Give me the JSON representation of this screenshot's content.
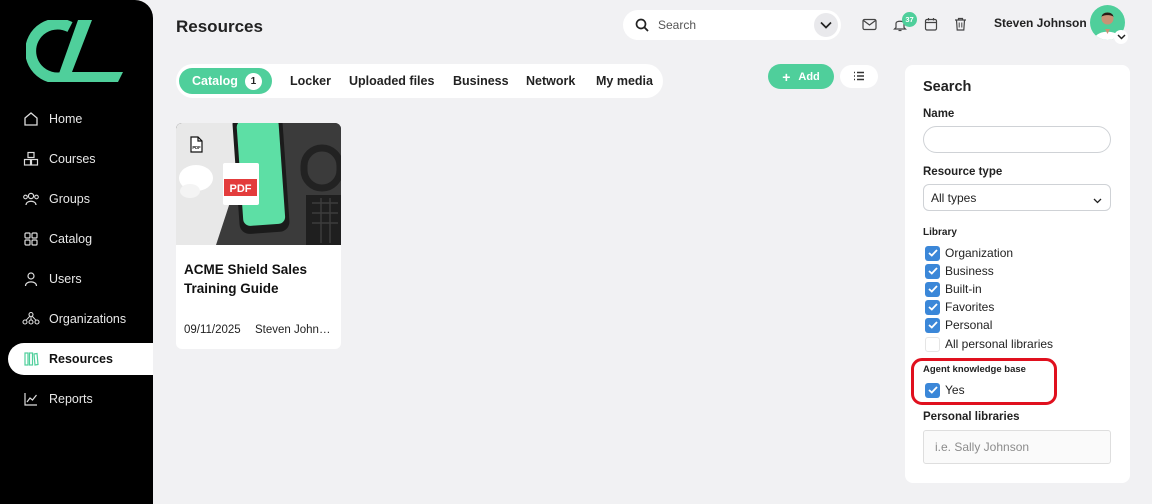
{
  "sidebar": {
    "items": [
      {
        "label": "Home",
        "icon": "home-icon"
      },
      {
        "label": "Courses",
        "icon": "courses-icon"
      },
      {
        "label": "Groups",
        "icon": "groups-icon"
      },
      {
        "label": "Catalog",
        "icon": "catalog-icon"
      },
      {
        "label": "Users",
        "icon": "user-icon"
      },
      {
        "label": "Organizations",
        "icon": "organizations-icon"
      },
      {
        "label": "Resources",
        "icon": "resources-icon",
        "active": true
      },
      {
        "label": "Reports",
        "icon": "reports-icon"
      }
    ]
  },
  "header": {
    "title": "Resources",
    "search_placeholder": "Search",
    "notification_count": "37",
    "user_name": "Steven Johnson"
  },
  "tabs": [
    {
      "label": "Catalog",
      "count": "1",
      "active": true
    },
    {
      "label": "Locker"
    },
    {
      "label": "Uploaded files"
    },
    {
      "label": "Business"
    },
    {
      "label": "Network"
    },
    {
      "label": "My media"
    }
  ],
  "toolbar": {
    "add_label": "Add"
  },
  "cards": [
    {
      "file_type": "PDF",
      "title": "ACME Shield Sales Training Guide",
      "date": "09/11/2025",
      "author": "Steven Johnson"
    }
  ],
  "filters": {
    "heading": "Search",
    "name_label": "Name",
    "name_value": "",
    "resource_type_label": "Resource type",
    "resource_type_value": "All types",
    "library_label": "Library",
    "library_options": [
      {
        "label": "Organization",
        "checked": true
      },
      {
        "label": "Business",
        "checked": true
      },
      {
        "label": "Built-in",
        "checked": true
      },
      {
        "label": "Favorites",
        "checked": true
      },
      {
        "label": "Personal",
        "checked": true
      },
      {
        "label": "All personal libraries",
        "checked": false
      }
    ],
    "agent_kb_label": "Agent knowledge base",
    "agent_kb_option": {
      "label": "Yes",
      "checked": true
    },
    "personal_libraries_label": "Personal libraries",
    "personal_libraries_placeholder": "i.e. Sally Johnson"
  },
  "colors": {
    "accent": "#4fcf9b",
    "checkbox": "#3b87d8",
    "highlight": "#e0101e",
    "sidebar": "#000000"
  }
}
